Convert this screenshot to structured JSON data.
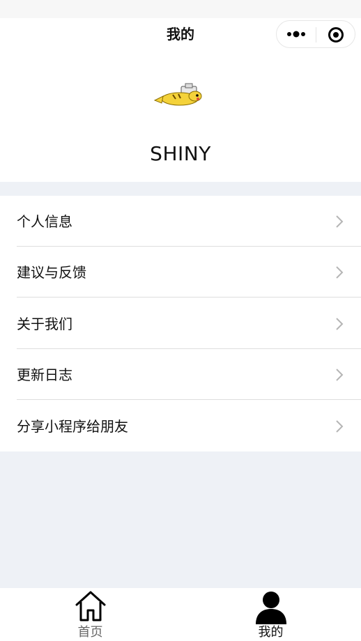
{
  "nav": {
    "title": "我的"
  },
  "profile": {
    "username": "SHINY"
  },
  "menu": {
    "items": [
      {
        "label": "个人信息"
      },
      {
        "label": "建议与反馈"
      },
      {
        "label": "关于我们"
      },
      {
        "label": "更新日志"
      },
      {
        "label": "分享小程序给朋友"
      }
    ]
  },
  "tabbar": {
    "tabs": [
      {
        "label": "首页",
        "icon": "home-icon",
        "color": "#666666"
      },
      {
        "label": "我的",
        "icon": "user-icon",
        "color": "#111111",
        "active": true
      }
    ]
  },
  "colors": {
    "page_bg": "#eef1f6",
    "surface": "#ffffff",
    "chevron": "#b5b5b5"
  }
}
